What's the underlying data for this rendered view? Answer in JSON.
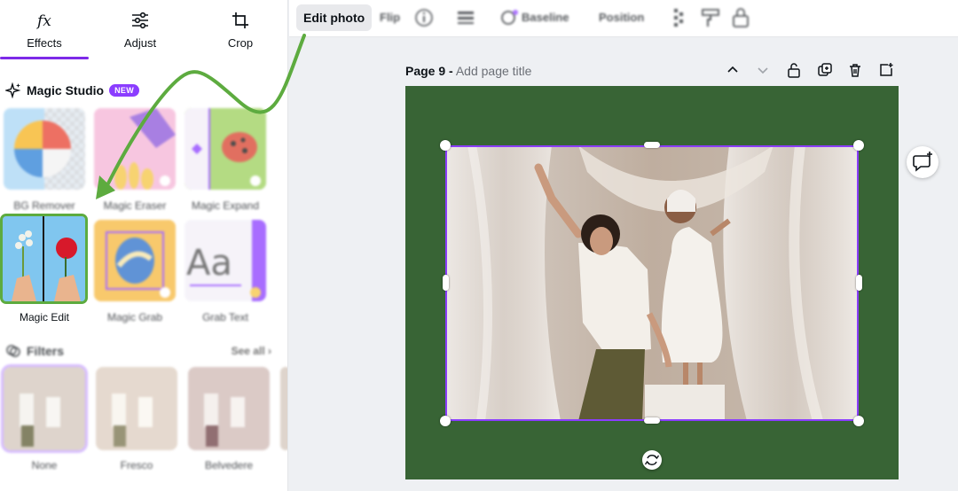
{
  "tabs": [
    {
      "label": "Effects",
      "icon": "fx-icon",
      "active": true
    },
    {
      "label": "Adjust",
      "icon": "sliders-icon",
      "active": false
    },
    {
      "label": "Crop",
      "icon": "crop-icon",
      "active": false
    }
  ],
  "magic_studio": {
    "title": "Magic Studio",
    "badge": "NEW",
    "tools": [
      {
        "label": "BG Remover"
      },
      {
        "label": "Magic Eraser"
      },
      {
        "label": "Magic Expand"
      },
      {
        "label": "Magic Edit",
        "selected": true
      },
      {
        "label": "Magic Grab"
      },
      {
        "label": "Grab Text"
      }
    ]
  },
  "filters": {
    "title": "Filters",
    "see_all": "See all",
    "items": [
      {
        "label": "None"
      },
      {
        "label": "Fresco"
      },
      {
        "label": "Belvedere"
      }
    ]
  },
  "toolbar": {
    "edit_photo": "Edit photo",
    "flip": "Flip",
    "baseline": "Baseline",
    "position": "Position"
  },
  "page": {
    "number_label": "Page 9 -",
    "title_placeholder": "Add page title"
  },
  "colors": {
    "accent": "#8b3dff",
    "page_background": "#386435",
    "highlight_green": "#5dab3f"
  }
}
